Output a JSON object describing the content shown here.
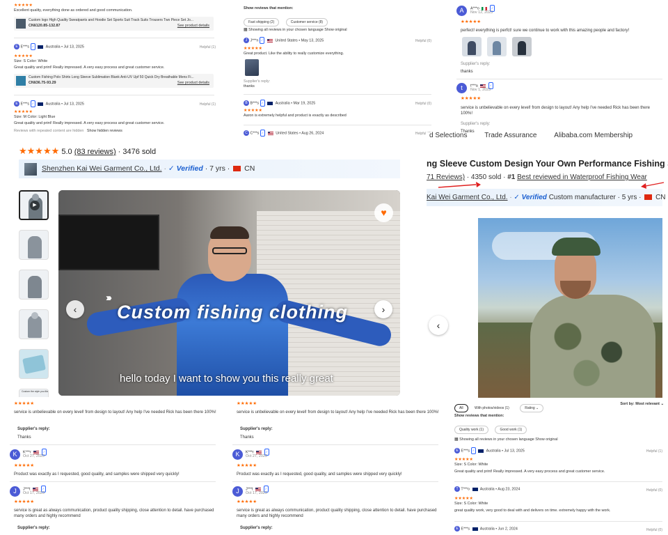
{
  "top_left": {
    "review0_text": "Excellent quality, everything done as ordered and good communication.",
    "product0_title": "Custom logo High Quality Sweatpants and Hoodie Set Sports Suit Track Suits Trousers Two Piece Set Jo...",
    "product0_price": "CN¥120.85-132.87",
    "see_details": "See product details",
    "review1_user": "E***s",
    "review1_meta": "Australia • Jul 13, 2025",
    "review1_helpful": "Helpful (1)",
    "review1_attrs": "Size:  S    Color:  White",
    "review1_text": "Great quality and print! Really impressed. A very easy process and great customer service.",
    "product1_title": "Custom Fishing Polo Shirts Long Sleeve Sublimation Blank Anti-UV Upf 50 Quick Dry Breathable Mens Fi...",
    "product1_price": "CN¥36.75-93.29",
    "review2_user": "E***s",
    "review2_meta": "Australia • Jul 13, 2025",
    "review2_helpful": "Helpful (1)",
    "review2_attrs": "Size:  M    Color:  Light Blue",
    "review2_text": "Great quality and print! Really impressed. A very easy process and great customer service.",
    "hidden_note": "Reviews with repeated content are hidden",
    "show_hidden": "Show hidden reviews"
  },
  "top_middle": {
    "mention_label": "Show reviews that mention:",
    "chip1": "Fast shipping (2)",
    "chip2": "Customer service (8)",
    "lang_note": "Showing all reviews in your chosen language",
    "show_original": "Show original",
    "r1_user": "J***n",
    "r1_meta": "United States • May 13, 2025",
    "r1_helpful": "Helpful (0)",
    "r1_text": "Great product. Like the ability to really customize everything.",
    "supplier_reply": "Supplier's reply:",
    "thanks": "thanks",
    "r2_user": "B***s",
    "r2_meta": "Australia • Mar 19, 2025",
    "r2_helpful": "Helpful (0)",
    "r2_text": "Aaron is extremely helpful and product is exactly as described",
    "r3_user": "C***s",
    "r3_meta": "United States • Aug 26, 2024",
    "r3_helpful": "Helpful (0)"
  },
  "top_right": {
    "r1_avatar": "A",
    "r1_user": "A***o",
    "r1_date": "Nov 12, 2023",
    "r1_text": "perfect! everything is perfct! sure we continue to work with this amazing people and factory!",
    "supplier_reply": "Supplier's reply:",
    "thanks": "thanks",
    "r2_avatar": "t",
    "r2_user": "t***a",
    "r2_date": "Nov 1, 2023",
    "r2_text": "service is unbelievable on every level! from design to layout! Any help I've needed Rick has been there 100%!",
    "supplier_reply2": "Supplier's reply:",
    "thanks2": "Thanks"
  },
  "center": {
    "rating": "5.0",
    "reviews_link": "(83 reviews)",
    "sold": "· 3476 sold",
    "company": "Shenzhen Kai Wei Garment Co., Ltd.",
    "verified": "Verified",
    "years": "· 7 yrs ·",
    "country": "CN",
    "video_title": "Custom fishing clothing",
    "video_subtitle": "hello today I want to show you this really great",
    "thumb_caption": "Custom the style you like"
  },
  "right": {
    "nav1": "d Selections",
    "nav2": "Trade Assurance",
    "nav3": "Alibaba.com Membership",
    "title": "ng Sleeve Custom Design Your Own Performance Fishing Shi",
    "reviews_count": "71 Reviews)",
    "sold": "· 4350 sold ·",
    "rank": "#1",
    "rank_link": "Best reviewed in Waterproof Fishing Wear",
    "company": "Kai Wei Garment Co., Ltd.",
    "verified": "Verified",
    "company_tail": "Custom manufacturer · 5 yrs ·",
    "country": "CN"
  },
  "bottom_left": {
    "r0_text": "service is unbelievable on every level! from design to layout! Any help I've needed Rick has been there 100%!",
    "supplier_reply": "Supplier's reply:",
    "thanks": "Thanks",
    "r1_avatar": "K",
    "r1_user": "K***r",
    "r1_date": "Oct 27, 2023",
    "r1_text": "Product was exactly as I requested, good quality, and samples were shipped very quickly!",
    "r2_avatar": "J",
    "r2_user": "J***t",
    "r2_date": "Oct 17, 2023",
    "r2_text": "service is great as always communication, product quality shipping, close attention to detail. have purchased many orders and highly recommend",
    "supplier_reply2": "Supplier's reply:"
  },
  "bottom_right": {
    "tab_all": "All",
    "tab_photos": "With photos/videos (1)",
    "tab_rating": "Rating ⌄",
    "sort": "Sort by: Most relevant ⌄",
    "mention_label": "Show reviews that mention:",
    "chip1": "Quality work (1)",
    "chip2": "Good work (1)",
    "lang_note": "Showing all reviews in your chosen language",
    "show_original": "Show original",
    "r1_user": "E***s",
    "r1_meta": "Australia • Jul 13, 2025",
    "r1_helpful": "Helpful (1)",
    "r1_attrs": "Size:  S    Color:  White",
    "r1_text": "Great quality and print! Really impressed. A very easy process and great customer service.",
    "r2_user": "T***o",
    "r2_meta": "Australia • Aug 23, 2024",
    "r2_helpful": "Helpful (0)",
    "r2_attrs": "Size:  S    Color:  White",
    "r2_text": "great quality work, very good to deal with and delivers on time. extremely happy with the work.",
    "r3_user": "E***s",
    "r3_meta": "Australia • Jun 2, 2024",
    "r3_helpful": "Helpful (0)"
  },
  "colors": {
    "star": "#ff6a00",
    "verified_blue": "#1a5fd0",
    "avatar": "#4b5bd6",
    "arrow_red": "#e02020"
  }
}
